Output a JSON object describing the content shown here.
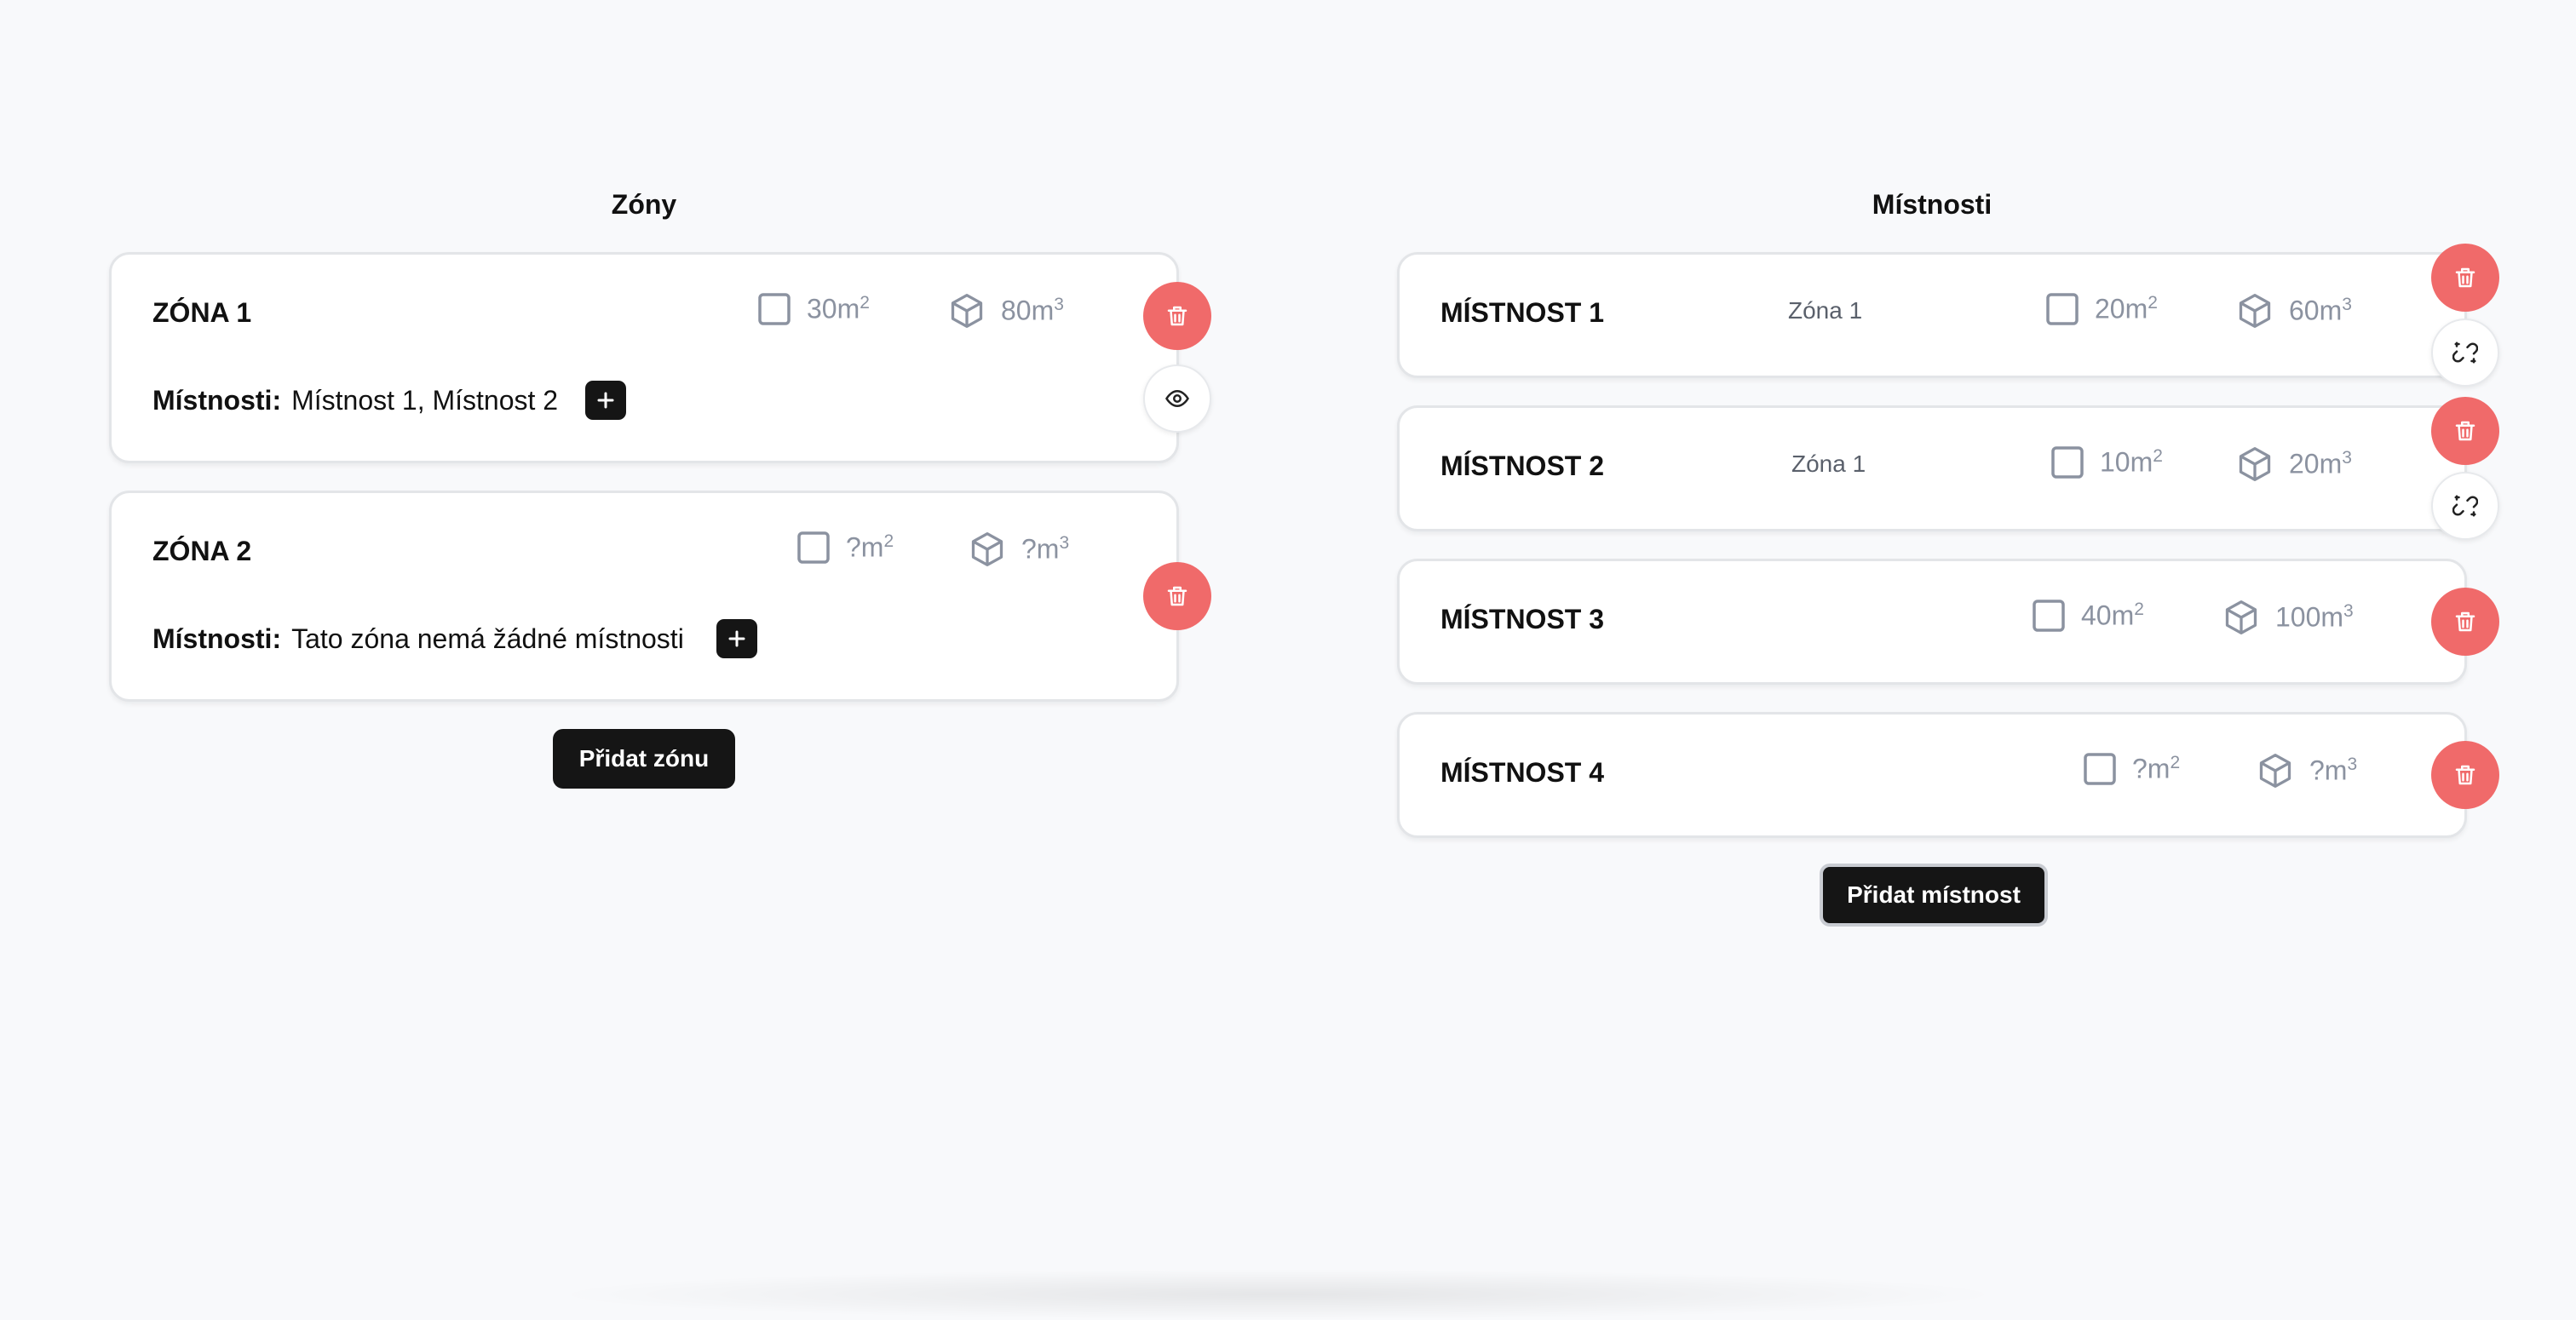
{
  "zones": {
    "title": "Zóny",
    "add_button": "Přidat zónu",
    "rooms_label": "Místnosti:",
    "items": [
      {
        "name": "ZÓNA 1",
        "area": "30m",
        "volume": "80m",
        "rooms": "Místnost 1, Místnost 2"
      },
      {
        "name": "ZÓNA 2",
        "area": "?m",
        "volume": "?m",
        "rooms": "Tato zóna nemá žádné místnosti"
      }
    ]
  },
  "rooms": {
    "title": "Místnosti",
    "add_button": "Přidat místnost",
    "items": [
      {
        "name": "MÍSTNOST 1",
        "zone": "Zóna 1",
        "area": "20m",
        "volume": "60m"
      },
      {
        "name": "MÍSTNOST 2",
        "zone": "Zóna 1",
        "area": "10m",
        "volume": "20m"
      },
      {
        "name": "MÍSTNOST 3",
        "zone": "",
        "area": "40m",
        "volume": "100m"
      },
      {
        "name": "MÍSTNOST 4",
        "zone": "",
        "area": "?m",
        "volume": "?m"
      }
    ]
  },
  "units": {
    "area_exp": "2",
    "volume_exp": "3"
  },
  "colors": {
    "delete": "#f06a6a",
    "primary": "#151515",
    "muted": "#8b92a0"
  },
  "icons": [
    "square-icon",
    "cube-icon",
    "trash-icon",
    "eye-icon",
    "unlink-icon",
    "plus-icon"
  ]
}
